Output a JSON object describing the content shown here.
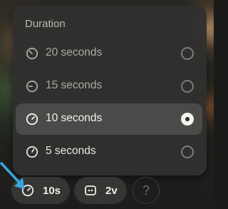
{
  "popup": {
    "title": "Duration",
    "options": [
      {
        "label": "20 seconds",
        "icon": "timer-20-icon",
        "selected": false
      },
      {
        "label": "15 seconds",
        "icon": "timer-15-icon",
        "selected": false
      },
      {
        "label": "10 seconds",
        "icon": "timer-10-icon",
        "selected": true
      },
      {
        "label": "5 seconds",
        "icon": "timer-5-icon",
        "selected": false
      }
    ]
  },
  "toolbar": {
    "duration_label": "10s",
    "variations_label": "2v",
    "help_label": "?"
  },
  "colors": {
    "accent_arrow": "#39a5e0",
    "selected_row": "#4a4a48",
    "popup_bg": "#2f2f2e"
  }
}
